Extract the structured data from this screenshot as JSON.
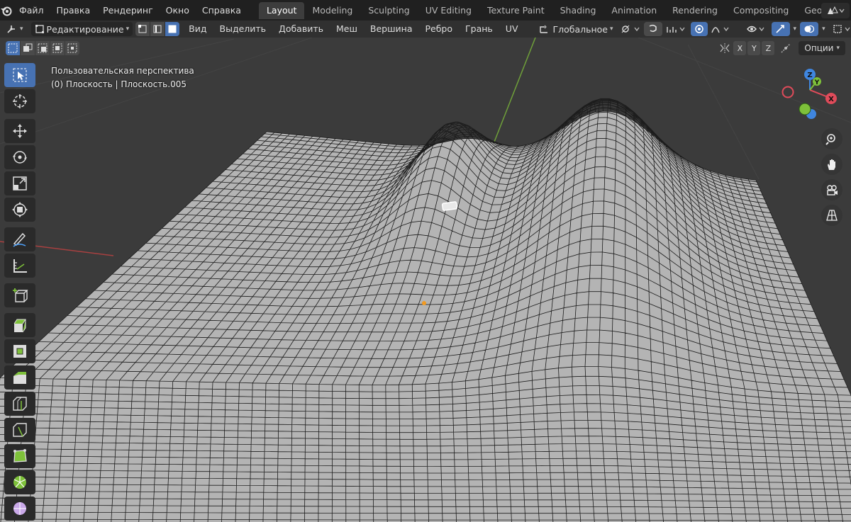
{
  "menu": [
    "Файл",
    "Правка",
    "Рендеринг",
    "Окно",
    "Справка"
  ],
  "workspaces": [
    "Layout",
    "Modeling",
    "Sculpting",
    "UV Editing",
    "Texture Paint",
    "Shading",
    "Animation",
    "Rendering",
    "Compositing",
    "Geometry Nodes"
  ],
  "active_workspace": "Layout",
  "header": {
    "mode": "Редактирование",
    "menus": [
      "Вид",
      "Выделить",
      "Добавить",
      "Меш",
      "Вершина",
      "Ребро",
      "Грань",
      "UV"
    ],
    "transform_orientation": "Глобальное"
  },
  "viewport": {
    "view_name": "Пользовательская перспектива",
    "object_info": "(0) Плоскость | Плоскость.005",
    "axes": [
      "X",
      "Y",
      "Z"
    ],
    "options_label": "Опции"
  },
  "gizmo": {
    "x": "X",
    "y": "Y",
    "z": "Z"
  },
  "colors": {
    "accent": "#4772b3",
    "axis_x": "#e04b5a",
    "axis_y": "#7ec13a",
    "axis_z": "#3f86e0",
    "mesh": "#b4b4b4",
    "wire": "#1c1c1c"
  }
}
